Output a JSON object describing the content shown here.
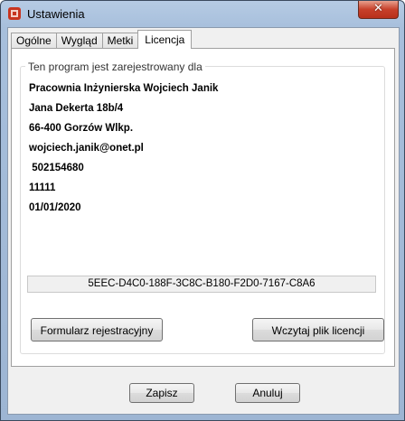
{
  "window": {
    "title": "Ustawienia",
    "close_glyph": "✕"
  },
  "tabs": [
    {
      "label": "Ogólne",
      "active": false
    },
    {
      "label": "Wygląd",
      "active": false
    },
    {
      "label": "Metki",
      "active": false
    },
    {
      "label": "Licencja",
      "active": true
    }
  ],
  "license": {
    "group_label": "Ten program jest zarejestrowany dla",
    "lines": [
      "Pracownia Inżynierska Wojciech Janik",
      "Jana Dekerta 18b/4",
      "66-400 Gorzów Wlkp.",
      "wojciech.janik@onet.pl",
      " 502154680",
      "11111",
      "01/01/2020"
    ],
    "key": "5EEC-D4C0-188F-3C8C-B180-F2D0-7167-C8A6",
    "register_button": "Formularz rejestracyjny",
    "load_button": "Wczytaj plik licencji"
  },
  "footer": {
    "save_button": "Zapisz",
    "cancel_button": "Anuluj"
  },
  "colors": {
    "close_button": "#c7402a",
    "app_icon": "#c8341f",
    "frame": "#a7bfdc"
  },
  "icons": {
    "app": "app-logo-icon",
    "close": "close-icon"
  }
}
